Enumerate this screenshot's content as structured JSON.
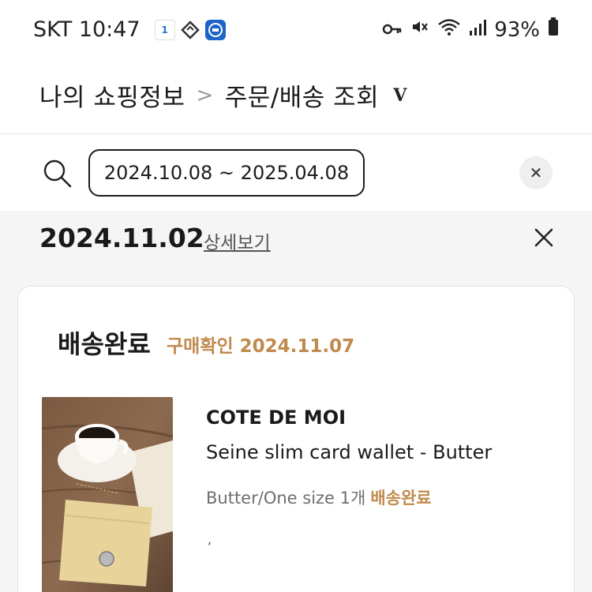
{
  "status_bar": {
    "carrier_time": "SKT 10:47",
    "battery": "93%",
    "app_icon_1_text": "1",
    "icons": [
      "app-11st-icon",
      "app-delivery-icon",
      "app-mobile-card-icon",
      "key-icon",
      "mute-icon",
      "wifi-icon",
      "signal-icon",
      "battery-icon"
    ]
  },
  "header": {
    "breadcrumb_root": "나의 쇼핑정보",
    "separator": ">",
    "breadcrumb_current": "주문/배송 조회",
    "caret": "V"
  },
  "search": {
    "date_range": "2024.10.08 ~ 2025.04.08",
    "clear_symbol": "✕"
  },
  "order": {
    "date": "2024.11.02",
    "detail_link": "상세보기",
    "close_symbol": "✕",
    "status_title": "배송완료",
    "confirm_text": "구매확인 2024.11.07",
    "item": {
      "brand": "COTE DE MOI",
      "name": "Seine slim card wallet - Butter",
      "option": "Butter/One size 1개",
      "option_status": "배송완료"
    },
    "tick": "‘"
  },
  "colors": {
    "accent": "#c08a4d",
    "background_gray": "#f5f5f5",
    "text": "#1a1a1a"
  }
}
